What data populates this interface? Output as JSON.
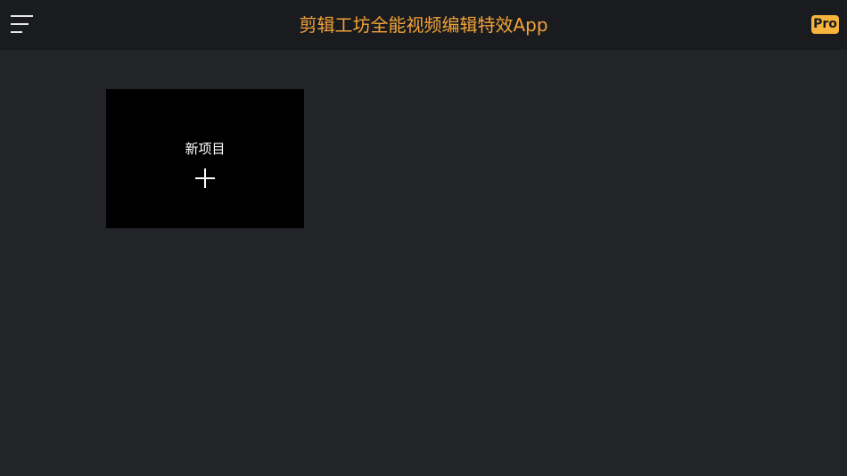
{
  "header": {
    "title": "剪辑工坊全能视频编辑特效App",
    "pro_label": "Pro",
    "menu_icon": "hamburger-menu-icon"
  },
  "main": {
    "new_project": {
      "label": "新项目",
      "icon": "plus-icon"
    }
  },
  "colors": {
    "background": "#232428",
    "topbar": "#1a1b1e",
    "accent": "#f2a33a",
    "pro_badge": "#f4b43d",
    "card": "#000000"
  }
}
